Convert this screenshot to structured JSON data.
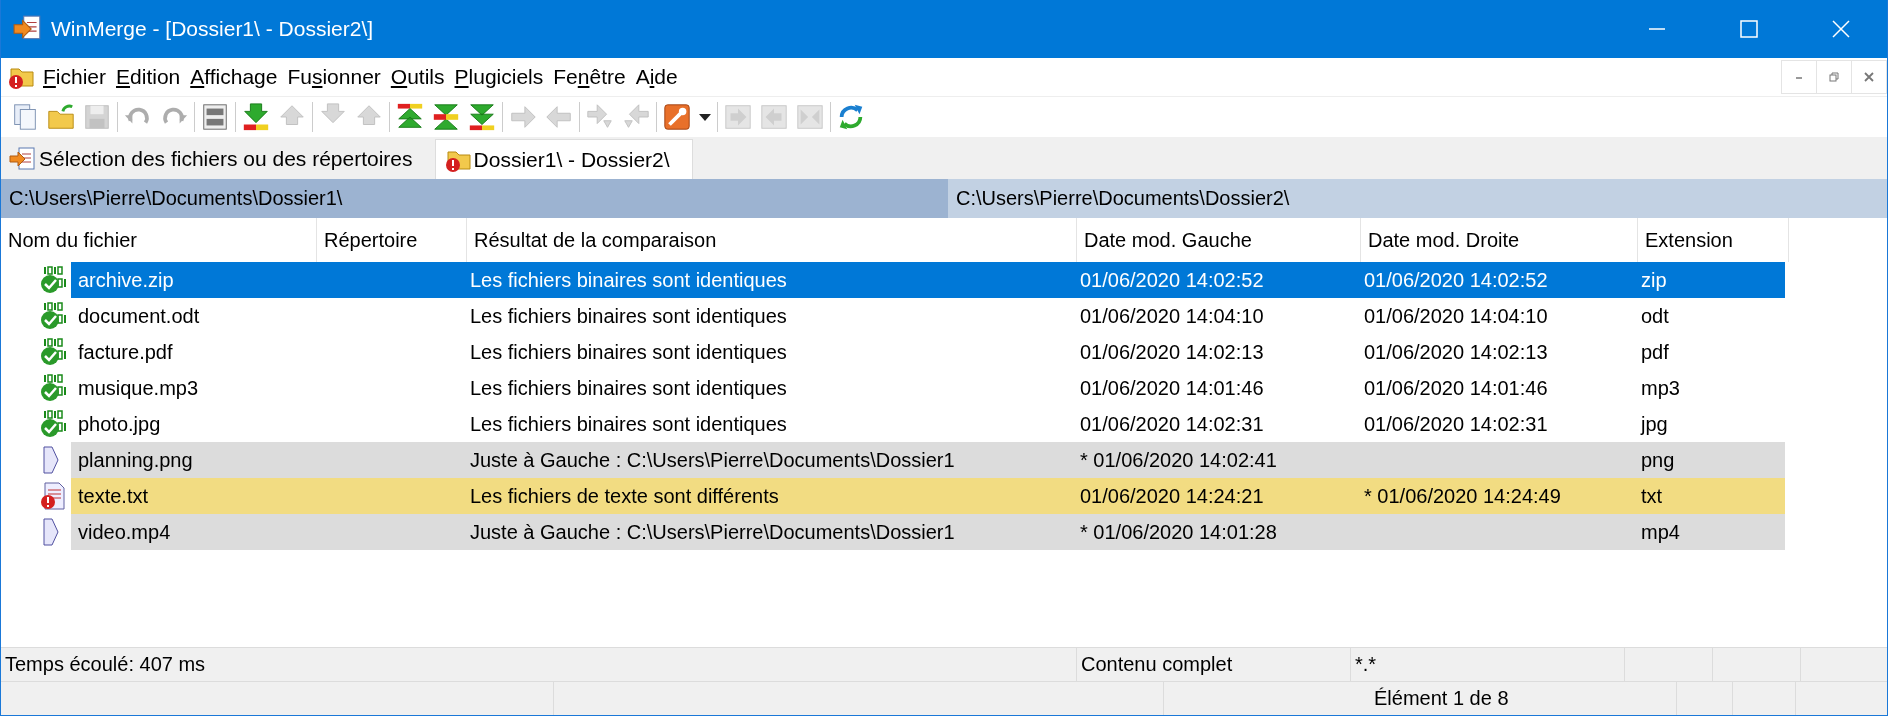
{
  "window": {
    "title": "WinMerge - [Dossier1\\ - Dossier2\\]"
  },
  "menu": [
    {
      "key": "F",
      "post": "ichier"
    },
    {
      "key": "E",
      "post": "dition"
    },
    {
      "key": "A",
      "post": "ffichage"
    },
    {
      "pre": "Fu",
      "key": "s",
      "post": "ionner"
    },
    {
      "key": "O",
      "post": "utils"
    },
    {
      "key": "P",
      "post": "lugiciels"
    },
    {
      "pre": "Fe",
      "key": "n",
      "post": "être"
    },
    {
      "pre": "A",
      "key": "i",
      "post": "de"
    }
  ],
  "toolbar": [
    {
      "kind": "documents",
      "disabled": false
    },
    {
      "kind": "folder",
      "disabled": false
    },
    {
      "kind": "disk",
      "disabled": true
    },
    {
      "kind": "separator"
    },
    {
      "kind": "undo",
      "disabled": true
    },
    {
      "kind": "redo",
      "disabled": true
    },
    {
      "kind": "separator"
    },
    {
      "kind": "compare",
      "disabled": false
    },
    {
      "kind": "separator"
    },
    {
      "kind": "down",
      "disabled": false
    },
    {
      "kind": "up",
      "disabled": true
    },
    {
      "kind": "separator"
    },
    {
      "kind": "down",
      "disabled": true
    },
    {
      "kind": "up",
      "disabled": true
    },
    {
      "kind": "separator"
    },
    {
      "kind": "double-up",
      "disabled": false
    },
    {
      "kind": "double-both",
      "disabled": false
    },
    {
      "kind": "double-down",
      "disabled": false
    },
    {
      "kind": "separator"
    },
    {
      "kind": "right",
      "disabled": true
    },
    {
      "kind": "left",
      "disabled": true
    },
    {
      "kind": "separator"
    },
    {
      "kind": "right-down",
      "disabled": true
    },
    {
      "kind": "left-down",
      "disabled": true
    },
    {
      "kind": "separator"
    },
    {
      "kind": "wrench",
      "disabled": false
    },
    {
      "kind": "caret",
      "disabled": false
    },
    {
      "kind": "separator"
    },
    {
      "kind": "panel-right",
      "disabled": true
    },
    {
      "kind": "panel-left",
      "disabled": true
    },
    {
      "kind": "panel-both",
      "disabled": true
    },
    {
      "kind": "separator"
    },
    {
      "kind": "refresh",
      "disabled": false
    }
  ],
  "tabs": [
    {
      "label": "Sélection des fichiers ou des répertoires",
      "kind": "open",
      "selected": false
    },
    {
      "label": "Dossier1\\ - Dossier2\\",
      "kind": "folder",
      "selected": true
    }
  ],
  "paths": [
    {
      "text": "C:\\Users\\Pierre\\Documents\\Dossier1\\",
      "active": true
    },
    {
      "text": "C:\\Users\\Pierre\\Documents\\Dossier2\\",
      "active": false
    }
  ],
  "table": {
    "columns": [
      "Nom du fichier",
      "Répertoire",
      "Résultat de la comparaison",
      "Date mod. Gauche",
      "Date mod. Droite",
      "Extension"
    ],
    "rows": [
      {
        "kind": "identical",
        "selected": true,
        "cells": [
          "archive.zip",
          "",
          "Les fichiers binaires sont identiques",
          "01/06/2020 14:02:52",
          "01/06/2020 14:02:52",
          "zip"
        ]
      },
      {
        "kind": "identical",
        "selected": false,
        "cells": [
          "document.odt",
          "",
          "Les fichiers binaires sont identiques",
          "01/06/2020 14:04:10",
          "01/06/2020 14:04:10",
          "odt"
        ]
      },
      {
        "kind": "identical",
        "selected": false,
        "cells": [
          "facture.pdf",
          "",
          "Les fichiers binaires sont identiques",
          "01/06/2020 14:02:13",
          "01/06/2020 14:02:13",
          "pdf"
        ]
      },
      {
        "kind": "identical",
        "selected": false,
        "cells": [
          "musique.mp3",
          "",
          "Les fichiers binaires sont identiques",
          "01/06/2020 14:01:46",
          "01/06/2020 14:01:46",
          "mp3"
        ]
      },
      {
        "kind": "identical",
        "selected": false,
        "cells": [
          "photo.jpg",
          "",
          "Les fichiers binaires sont identiques",
          "01/06/2020 14:02:31",
          "01/06/2020 14:02:31",
          "jpg"
        ]
      },
      {
        "kind": "left_only",
        "selected": false,
        "cells": [
          "planning.png",
          "",
          "Juste à Gauche : C:\\Users\\Pierre\\Documents\\Dossier1",
          "* 01/06/2020 14:02:41",
          "",
          "png"
        ]
      },
      {
        "kind": "different",
        "selected": false,
        "cells": [
          "texte.txt",
          "",
          "Les fichiers de texte sont différents",
          "01/06/2020 14:24:21",
          "* 01/06/2020 14:24:49",
          "txt"
        ]
      },
      {
        "kind": "left_only",
        "selected": false,
        "cells": [
          "video.mp4",
          "",
          "Juste à Gauche : C:\\Users\\Pierre\\Documents\\Dossier1",
          "* 01/06/2020 14:01:28",
          "",
          "mp4"
        ]
      }
    ]
  },
  "status_bar": {
    "row_1": [
      "Temps écoulé: 407 ms",
      "Contenu complet",
      "*.*"
    ],
    "row_2": [
      "Élément 1 de 8"
    ]
  }
}
